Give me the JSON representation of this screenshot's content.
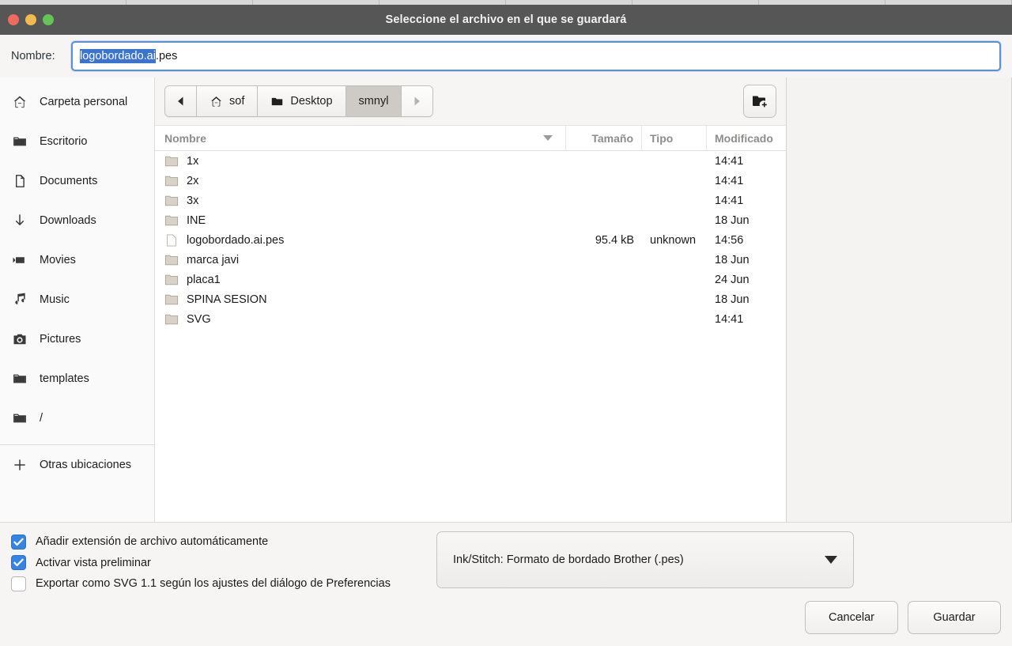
{
  "window": {
    "title": "Seleccione el archivo en el que se guardará",
    "traffic_lights": {
      "close": "#ec6a5e",
      "minimize": "#f2bb4e",
      "zoom": "#62c554"
    }
  },
  "name_row": {
    "label": "Nombre:",
    "value_selected": "logobordado.ai",
    "value_rest": ".pes",
    "full_value": "logobordado.ai.pes",
    "selection_color": "#3b73d4"
  },
  "pathbar": {
    "back_label": "◀",
    "forward_label": "▶",
    "segments": [
      {
        "label": "sof",
        "icon": "home-icon",
        "active": false
      },
      {
        "label": "Desktop",
        "icon": "folder-icon",
        "active": false
      },
      {
        "label": "smnyl",
        "icon": "",
        "active": true
      }
    ],
    "new_folder_tooltip": "Crear carpeta"
  },
  "sidebar": {
    "items": [
      {
        "label": "Carpeta personal",
        "icon": "home-icon"
      },
      {
        "label": "Escritorio",
        "icon": "folder-icon"
      },
      {
        "label": "Documents",
        "icon": "document-icon"
      },
      {
        "label": "Downloads",
        "icon": "download-icon"
      },
      {
        "label": "Movies",
        "icon": "video-camera-icon"
      },
      {
        "label": "Music",
        "icon": "music-note-icon"
      },
      {
        "label": "Pictures",
        "icon": "camera-icon"
      },
      {
        "label": "templates",
        "icon": "folder-icon"
      },
      {
        "label": "/",
        "icon": "folder-icon"
      }
    ],
    "other_locations": {
      "label": "Otras ubicaciones",
      "icon": "plus-icon"
    }
  },
  "file_list": {
    "columns": [
      "Nombre",
      "Tamaño",
      "Tipo",
      "Modificado"
    ],
    "sort_column": "Nombre",
    "sort_direction": "descending",
    "rows": [
      {
        "name": "1x",
        "size": "",
        "type": "",
        "modified": "14:41",
        "kind": "folder"
      },
      {
        "name": "2x",
        "size": "",
        "type": "",
        "modified": "14:41",
        "kind": "folder"
      },
      {
        "name": "3x",
        "size": "",
        "type": "",
        "modified": "14:41",
        "kind": "folder"
      },
      {
        "name": "INE",
        "size": "",
        "type": "",
        "modified": "18 Jun",
        "kind": "folder"
      },
      {
        "name": "logobordado.ai.pes",
        "size": "95.4 kB",
        "type": "unknown",
        "modified": "14:56",
        "kind": "file"
      },
      {
        "name": "marca javi",
        "size": "",
        "type": "",
        "modified": "18 Jun",
        "kind": "folder"
      },
      {
        "name": "placa1",
        "size": "",
        "type": "",
        "modified": "24 Jun",
        "kind": "folder"
      },
      {
        "name": "SPINA SESION",
        "size": "",
        "type": "",
        "modified": "18 Jun",
        "kind": "folder"
      },
      {
        "name": "SVG",
        "size": "",
        "type": "",
        "modified": "14:41",
        "kind": "folder"
      }
    ]
  },
  "options": {
    "checkboxes": [
      {
        "label": "Añadir extensión de archivo automáticamente",
        "checked": true
      },
      {
        "label": "Activar vista preliminar",
        "checked": true
      },
      {
        "label": "Exportar como SVG 1.1 según los ajustes del diálogo de Preferencias",
        "checked": false
      }
    ],
    "format_select": {
      "value": "Ink/Stitch: Formato de bordado Brother (.pes)"
    }
  },
  "actions": {
    "cancel_label": "Cancelar",
    "save_label": "Guardar"
  }
}
